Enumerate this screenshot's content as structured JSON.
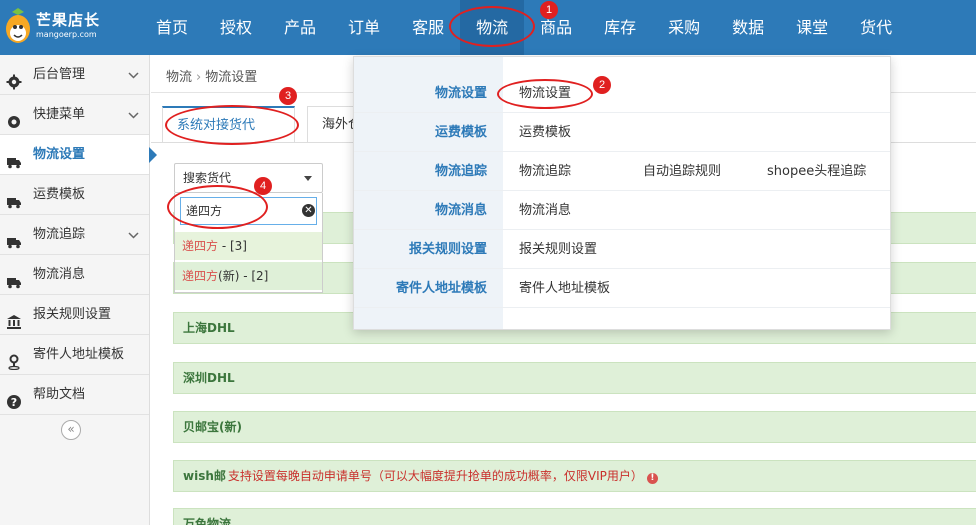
{
  "logo": {
    "name": "芒果店长",
    "sub": "mangoerp.com"
  },
  "nav": [
    {
      "label": "首页"
    },
    {
      "label": "授权"
    },
    {
      "label": "产品"
    },
    {
      "label": "订单"
    },
    {
      "label": "客服"
    },
    {
      "label": "物流",
      "active": true
    },
    {
      "label": "商品"
    },
    {
      "label": "库存"
    },
    {
      "label": "采购"
    },
    {
      "label": "数据"
    },
    {
      "label": "课堂"
    },
    {
      "label": "货代"
    }
  ],
  "sidebar": {
    "items": [
      {
        "label": "后台管理",
        "icon": "gear-icon",
        "expandable": true
      },
      {
        "label": "快捷菜单",
        "icon": "cog-icon",
        "expandable": true
      },
      {
        "label": "物流设置",
        "icon": "truck-icon",
        "active": true
      },
      {
        "label": "运费模板",
        "icon": "truck-icon"
      },
      {
        "label": "物流追踪",
        "icon": "truck-icon",
        "expandable": true
      },
      {
        "label": "物流消息",
        "icon": "truck-icon"
      },
      {
        "label": "报关规则设置",
        "icon": "bank-icon"
      },
      {
        "label": "寄件人地址模板",
        "icon": "map-pin-icon"
      },
      {
        "label": "帮助文档",
        "icon": "question-icon"
      }
    ],
    "collapse_symbol": "«"
  },
  "breadcrumb": {
    "root": "物流",
    "sep": "›",
    "current": "物流设置"
  },
  "tabs": [
    {
      "label": "系统对接货代",
      "active": true
    },
    {
      "label": "海外仓"
    }
  ],
  "forwarder_select": {
    "label": "搜索货代",
    "search_value": "递四方",
    "options": [
      {
        "highlight": "递四方",
        "rest": " - [3]"
      },
      {
        "highlight": "递四方",
        "rest": "(新) - [2]"
      }
    ]
  },
  "panels": [
    {
      "title": ""
    },
    {
      "title": ""
    },
    {
      "title": "上海DHL"
    },
    {
      "title": "深圳DHL"
    },
    {
      "title": "贝邮宝(新)"
    },
    {
      "title": "wish邮",
      "note": "支持设置每晚自动申请单号（可以大幅度提升抢单的成功概率，仅限VIP用户）"
    },
    {
      "title": "万色物流"
    }
  ],
  "mega_menu": {
    "rows": [
      {
        "category": "物流设置",
        "links": [
          "物流设置"
        ]
      },
      {
        "category": "运费模板",
        "links": [
          "运费模板"
        ]
      },
      {
        "category": "物流追踪",
        "links": [
          "物流追踪",
          "自动追踪规则",
          "shopee头程追踪"
        ]
      },
      {
        "category": "物流消息",
        "links": [
          "物流消息"
        ]
      },
      {
        "category": "报关规则设置",
        "links": [
          "报关规则设置"
        ]
      },
      {
        "category": "寄件人地址模板",
        "links": [
          "寄件人地址模板"
        ]
      }
    ]
  },
  "annotations": [
    "1",
    "2",
    "3",
    "4"
  ],
  "colors": {
    "nav_bg": "#2d7ab8",
    "accent": "#2d7ab8",
    "annotation": "#e02020",
    "panel_bg": "#dff0d8"
  }
}
